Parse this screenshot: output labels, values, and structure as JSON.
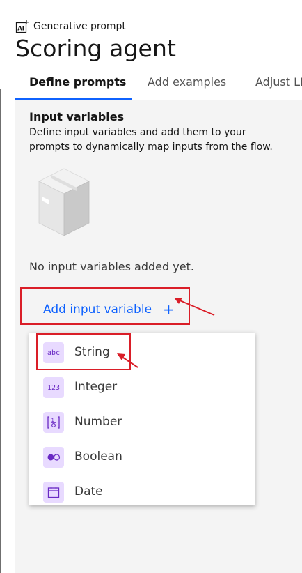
{
  "header": {
    "kicker": "Generative prompt",
    "title": "Scoring agent"
  },
  "tabs": [
    {
      "label": "Define prompts",
      "active": true
    },
    {
      "label": "Add examples",
      "active": false
    },
    {
      "label": "Adjust LL",
      "active": false
    }
  ],
  "input_variables": {
    "title": "Input variables",
    "description": "Define input variables and add them to your prompts to dynamically map inputs from the flow.",
    "empty_state": "No input variables added yet.",
    "add_button_label": "Add input variable",
    "add_button_icon": "+"
  },
  "type_menu": {
    "items": [
      {
        "label": "String",
        "icon": "abc-icon",
        "glyph": "abc"
      },
      {
        "label": "Integer",
        "icon": "integer-icon",
        "glyph": "123"
      },
      {
        "label": "Number",
        "icon": "number-icon",
        "glyph": "[1.0]"
      },
      {
        "label": "Boolean",
        "icon": "boolean-toggle-icon",
        "glyph": ""
      },
      {
        "label": "Date",
        "icon": "calendar-icon",
        "glyph": ""
      }
    ]
  },
  "colors": {
    "accent": "#0f62fe",
    "annotation": "#da1e28",
    "icon_bg": "#e8daff",
    "icon_fg": "#6929c4",
    "panel_bg": "#f4f4f4"
  }
}
